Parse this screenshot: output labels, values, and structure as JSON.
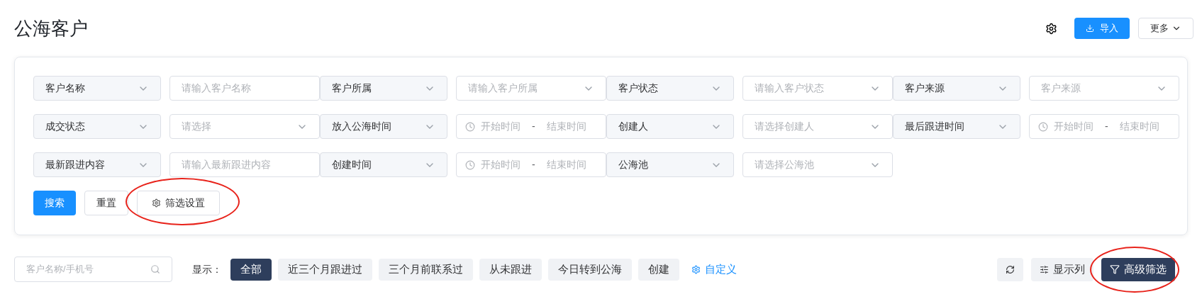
{
  "page_title": "公海客户",
  "header_actions": {
    "import_label": "导入",
    "more_label": "更多"
  },
  "filters": [
    [
      {
        "label": "客户名称",
        "field": {
          "kind": "input",
          "placeholder": "请输入客户名称"
        }
      },
      {
        "label": "客户所属",
        "field": {
          "kind": "select",
          "placeholder": "请输入客户所属"
        }
      },
      {
        "label": "客户状态",
        "field": {
          "kind": "select",
          "placeholder": "请输入客户状态"
        }
      },
      {
        "label": "客户来源",
        "field": {
          "kind": "select",
          "placeholder": "客户来源"
        }
      }
    ],
    [
      {
        "label": "成交状态",
        "field": {
          "kind": "select",
          "placeholder": "请选择"
        }
      },
      {
        "label": "放入公海时间",
        "field": {
          "kind": "date-range",
          "start": "开始时间",
          "separator": "-",
          "end": "结束时间"
        }
      },
      {
        "label": "创建人",
        "field": {
          "kind": "select",
          "placeholder": "请选择创建人"
        }
      },
      {
        "label": "最后跟进时间",
        "field": {
          "kind": "date-range",
          "start": "开始时间",
          "separator": "-",
          "end": "结束时间"
        }
      }
    ],
    [
      {
        "label": "最新跟进内容",
        "field": {
          "kind": "input",
          "placeholder": "请输入最新跟进内容"
        }
      },
      {
        "label": "创建时间",
        "field": {
          "kind": "date-range",
          "start": "开始时间",
          "separator": "-",
          "end": "结束时间"
        }
      },
      {
        "label": "公海池",
        "field": {
          "kind": "select",
          "placeholder": "请选择公海池"
        }
      }
    ]
  ],
  "filter_buttons": [
    {
      "kind": "primary",
      "label": "搜索",
      "circled": false
    },
    {
      "kind": "plain",
      "label": "重置",
      "circled": false
    },
    {
      "kind": "settings",
      "label": "筛选设置",
      "circled": true
    }
  ],
  "search": {
    "placeholder": "客户名称/手机号"
  },
  "view_label": "显示：",
  "views": [
    {
      "label": "全部",
      "selected": true
    },
    {
      "label": "近三个月跟进过",
      "selected": false
    },
    {
      "label": "三个月前联系过",
      "selected": false
    },
    {
      "label": "从未跟进",
      "selected": false
    },
    {
      "label": "今日转到公海",
      "selected": false
    },
    {
      "label": "创建",
      "selected": false
    }
  ],
  "custom_view_label": "自定义",
  "tools": [
    {
      "kind": "refresh",
      "circled": false
    },
    {
      "kind": "columns",
      "label": "显示列",
      "circled": false
    },
    {
      "kind": "advanced",
      "label": "高级筛选",
      "circled": true
    }
  ]
}
